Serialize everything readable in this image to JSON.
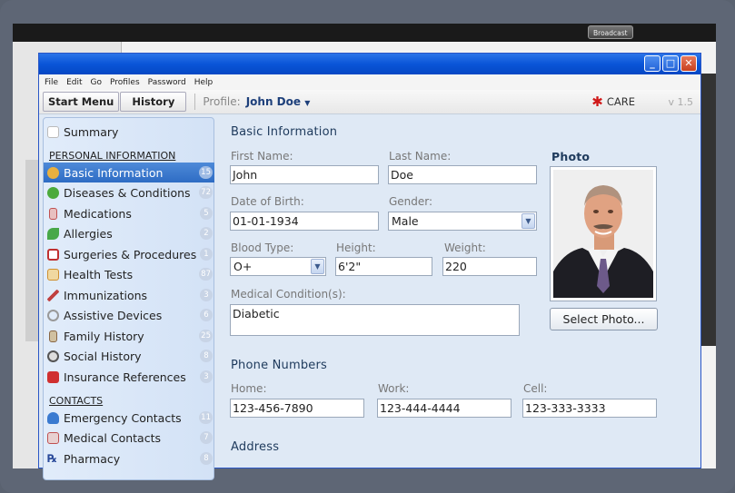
{
  "background": {
    "broadcast_label": "Broadcast"
  },
  "window": {
    "menu": [
      "File",
      "Edit",
      "Go",
      "Profiles",
      "Password",
      "Help"
    ],
    "toolbar": {
      "start_menu": "Start Menu",
      "history": "History",
      "profile_label": "Profile:",
      "profile_value": "John Doe",
      "care_label": "CARE",
      "version": "v 1.5"
    }
  },
  "sidebar": {
    "summary": "Summary",
    "personal_header": "PERSONAL INFORMATION",
    "contacts_header": "CONTACTS",
    "items": [
      {
        "label": "Basic Information",
        "count": "15",
        "icon": "person-icon",
        "color": "#e8b040"
      },
      {
        "label": "Diseases & Conditions",
        "count": "72",
        "icon": "disease-icon",
        "color": "#4caa3c"
      },
      {
        "label": "Medications",
        "count": "5",
        "icon": "medication-icon",
        "color": "#c05050"
      },
      {
        "label": "Allergies",
        "count": "2",
        "icon": "allergy-icon",
        "color": "#48a848"
      },
      {
        "label": "Surgeries & Procedures",
        "count": "1",
        "icon": "surgery-icon",
        "color": "#c03030"
      },
      {
        "label": "Health Tests",
        "count": "87",
        "icon": "test-icon",
        "color": "#d09030"
      },
      {
        "label": "Immunizations",
        "count": "3",
        "icon": "syringe-icon",
        "color": "#c04040"
      },
      {
        "label": "Assistive Devices",
        "count": "6",
        "icon": "device-icon",
        "color": "#999999"
      },
      {
        "label": "Family History",
        "count": "25",
        "icon": "family-icon",
        "color": "#886644"
      },
      {
        "label": "Social History",
        "count": "8",
        "icon": "social-icon",
        "color": "#555555"
      },
      {
        "label": "Insurance References",
        "count": "3",
        "icon": "insurance-icon",
        "color": "#d03030"
      }
    ],
    "contacts": [
      {
        "label": "Emergency Contacts",
        "count": "11",
        "icon": "emergency-contact-icon",
        "color": "#3a7ad0"
      },
      {
        "label": "Medical Contacts",
        "count": "7",
        "icon": "medical-contact-icon",
        "color": "#c05050"
      },
      {
        "label": "Pharmacy",
        "count": "8",
        "icon": "pharmacy-icon",
        "color": "#2a4a9a"
      }
    ]
  },
  "form": {
    "basic_title": "Basic Information",
    "first_name_label": "First Name:",
    "first_name": "John",
    "last_name_label": "Last Name:",
    "last_name": "Doe",
    "dob_label": "Date of Birth:",
    "dob": "01-01-1934",
    "gender_label": "Gender:",
    "gender": "Male",
    "blood_label": "Blood Type:",
    "blood": "O+",
    "height_label": "Height:",
    "height": "6'2\"",
    "weight_label": "Weight:",
    "weight": "220",
    "medical_label": "Medical Condition(s):",
    "medical": "Diabetic",
    "photo_title": "Photo",
    "select_photo": "Select Photo...",
    "phone_title": "Phone Numbers",
    "home_label": "Home:",
    "home": "123-456-7890",
    "work_label": "Work:",
    "work": "123-444-4444",
    "cell_label": "Cell:",
    "cell": "123-333-3333",
    "address_title": "Address"
  }
}
